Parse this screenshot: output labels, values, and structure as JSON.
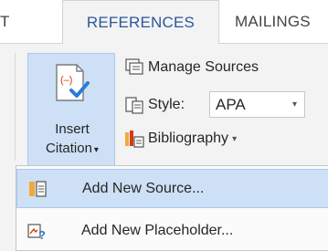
{
  "tabs": {
    "partial_label": "T",
    "active_label": "REFERENCES",
    "next_label": "MAILINGS"
  },
  "insert_citation": {
    "line1": "Insert",
    "line2": "Citation",
    "caret": "▾"
  },
  "commands": {
    "manage_sources": "Manage Sources",
    "style_label": "Style:",
    "style_value": "APA",
    "bibliography": "Bibliography",
    "caret": "▾"
  },
  "menu": {
    "items": [
      {
        "label": "Add New Source...",
        "highlighted": true
      },
      {
        "label": "Add New Placeholder...",
        "highlighted": false
      }
    ]
  },
  "colors": {
    "accent_blue": "#2b579a",
    "hover_fill": "#cde0f5",
    "hover_border": "#a9c9ee"
  },
  "icons": [
    "insert-citation-icon",
    "manage-sources-icon",
    "style-icon",
    "bibliography-icon",
    "add-source-icon",
    "add-placeholder-icon"
  ]
}
